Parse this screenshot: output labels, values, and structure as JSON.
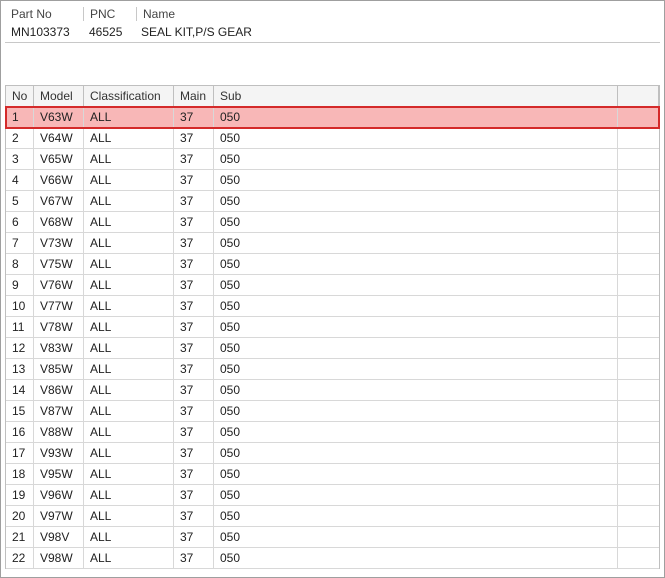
{
  "info": {
    "headers": {
      "partNo": "Part No",
      "pnc": "PNC",
      "name": "Name"
    },
    "values": {
      "partNo": "MN103373",
      "pnc": "46525",
      "name": "SEAL KIT,P/S GEAR"
    }
  },
  "list": {
    "headers": {
      "no": "No",
      "model": "Model",
      "classification": "Classification",
      "main": "Main",
      "sub": "Sub"
    },
    "selectedIndex": 0,
    "rows": [
      {
        "no": "1",
        "model": "V63W",
        "classification": "ALL",
        "main": "37",
        "sub": "050"
      },
      {
        "no": "2",
        "model": "V64W",
        "classification": "ALL",
        "main": "37",
        "sub": "050"
      },
      {
        "no": "3",
        "model": "V65W",
        "classification": "ALL",
        "main": "37",
        "sub": "050"
      },
      {
        "no": "4",
        "model": "V66W",
        "classification": "ALL",
        "main": "37",
        "sub": "050"
      },
      {
        "no": "5",
        "model": "V67W",
        "classification": "ALL",
        "main": "37",
        "sub": "050"
      },
      {
        "no": "6",
        "model": "V68W",
        "classification": "ALL",
        "main": "37",
        "sub": "050"
      },
      {
        "no": "7",
        "model": "V73W",
        "classification": "ALL",
        "main": "37",
        "sub": "050"
      },
      {
        "no": "8",
        "model": "V75W",
        "classification": "ALL",
        "main": "37",
        "sub": "050"
      },
      {
        "no": "9",
        "model": "V76W",
        "classification": "ALL",
        "main": "37",
        "sub": "050"
      },
      {
        "no": "10",
        "model": "V77W",
        "classification": "ALL",
        "main": "37",
        "sub": "050"
      },
      {
        "no": "11",
        "model": "V78W",
        "classification": "ALL",
        "main": "37",
        "sub": "050"
      },
      {
        "no": "12",
        "model": "V83W",
        "classification": "ALL",
        "main": "37",
        "sub": "050"
      },
      {
        "no": "13",
        "model": "V85W",
        "classification": "ALL",
        "main": "37",
        "sub": "050"
      },
      {
        "no": "14",
        "model": "V86W",
        "classification": "ALL",
        "main": "37",
        "sub": "050"
      },
      {
        "no": "15",
        "model": "V87W",
        "classification": "ALL",
        "main": "37",
        "sub": "050"
      },
      {
        "no": "16",
        "model": "V88W",
        "classification": "ALL",
        "main": "37",
        "sub": "050"
      },
      {
        "no": "17",
        "model": "V93W",
        "classification": "ALL",
        "main": "37",
        "sub": "050"
      },
      {
        "no": "18",
        "model": "V95W",
        "classification": "ALL",
        "main": "37",
        "sub": "050"
      },
      {
        "no": "19",
        "model": "V96W",
        "classification": "ALL",
        "main": "37",
        "sub": "050"
      },
      {
        "no": "20",
        "model": "V97W",
        "classification": "ALL",
        "main": "37",
        "sub": "050"
      },
      {
        "no": "21",
        "model": "V98V",
        "classification": "ALL",
        "main": "37",
        "sub": "050"
      },
      {
        "no": "22",
        "model": "V98W",
        "classification": "ALL",
        "main": "37",
        "sub": "050"
      }
    ]
  }
}
